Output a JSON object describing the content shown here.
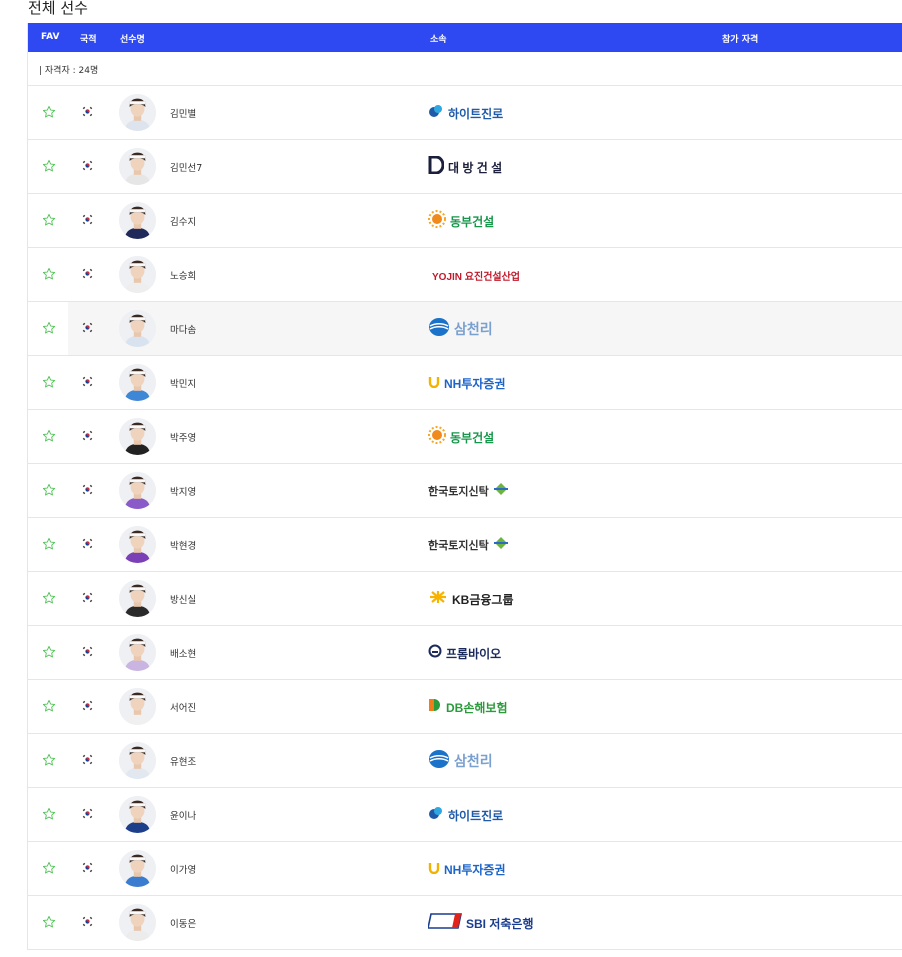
{
  "page": {
    "title": "전체 선수"
  },
  "table": {
    "headers": {
      "fav": "FAV",
      "nation": "국적",
      "name": "선수명",
      "team": "소속",
      "qual": "참가 자격"
    },
    "count_label": "| 자격자 : 24명"
  },
  "players": [
    {
      "name": "김민별",
      "sponsor": "하이트진로",
      "logo": "hite-logo",
      "color": "#1e5aa8",
      "shirt": "#dde4ee"
    },
    {
      "name": "김민선7",
      "sponsor": "대 방 건 설",
      "logo": "daebang-logo",
      "color": "#1b1f3b",
      "shirt": "#e6e6e6"
    },
    {
      "name": "김수지",
      "sponsor": "동부건설",
      "logo": "dongbu-logo",
      "color": "#16964a",
      "shirt": "#1f2a5a"
    },
    {
      "name": "노승희",
      "sponsor": "YOJIN 요진건설산업",
      "logo": "yojin-logo",
      "color": "#c01a2c",
      "shirt": "#eeeeee"
    },
    {
      "name": "마다솜",
      "sponsor": "삼천리",
      "logo": "samchully-logo",
      "color": "#7aa0cf",
      "shirt": "#d9e3f0"
    },
    {
      "name": "박민지",
      "sponsor": "NH투자증권",
      "logo": "nh-logo",
      "color": "#1d64c8",
      "shirt": "#3e86d6"
    },
    {
      "name": "박주영",
      "sponsor": "동부건설",
      "logo": "dongbu-logo",
      "color": "#16964a",
      "shirt": "#222222"
    },
    {
      "name": "박지영",
      "sponsor": "한국토지신탁",
      "logo": "koreit-logo",
      "color": "#333333",
      "shirt": "#8a5ac8"
    },
    {
      "name": "박현경",
      "sponsor": "한국토지신탁",
      "logo": "koreit-logo",
      "color": "#333333",
      "shirt": "#7b3fb6"
    },
    {
      "name": "방신실",
      "sponsor": "KB금융그룹",
      "logo": "kb-logo",
      "color": "#222222",
      "shirt": "#2a2a2a"
    },
    {
      "name": "배소현",
      "sponsor": "프롬바이오",
      "logo": "frombio-logo",
      "color": "#1a2a5c",
      "shirt": "#c9b4e2"
    },
    {
      "name": "서어진",
      "sponsor": "DB손해보험",
      "logo": "db-logo",
      "color": "#2a9a3a",
      "shirt": "#f0f0f0"
    },
    {
      "name": "유현조",
      "sponsor": "삼천리",
      "logo": "samchully-logo",
      "color": "#7aa0cf",
      "shirt": "#e2e8f0"
    },
    {
      "name": "윤이나",
      "sponsor": "하이트진로",
      "logo": "hite-logo",
      "color": "#1e5aa8",
      "shirt": "#1d3f8a"
    },
    {
      "name": "이가영",
      "sponsor": "NH투자증권",
      "logo": "nh-logo",
      "color": "#1d64c8",
      "shirt": "#3a7ccf"
    },
    {
      "name": "이동은",
      "sponsor": "SBI 저축은행",
      "logo": "sbi-logo",
      "color": "#1a3d8f",
      "shirt": "#ececec"
    }
  ],
  "hover_row": 4,
  "colors": {
    "header_bg": "#2e48f2",
    "star": "#54c45a",
    "flag_red": "#cd2e3a",
    "flag_blue": "#0047a0"
  }
}
